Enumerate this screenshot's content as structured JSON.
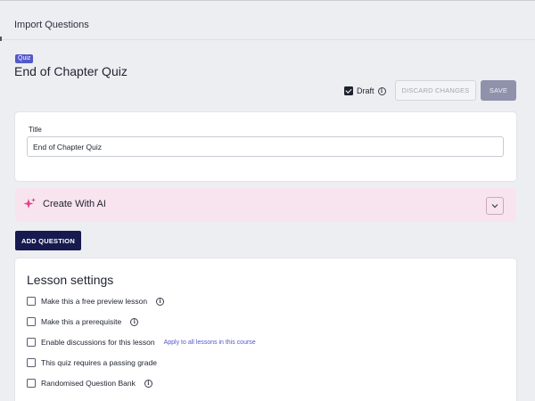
{
  "topbar": {
    "tab_label": "Import Questions"
  },
  "header": {
    "badge": "Quiz",
    "title": "End of Chapter Quiz",
    "draft_label": "Draft",
    "draft_checked": true,
    "discard_label": "DISCARD CHANGES",
    "save_label": "SAVE"
  },
  "title_card": {
    "label": "Title",
    "value": "End of Chapter Quiz"
  },
  "ai_card": {
    "label": "Create With AI",
    "icon": "sparkle-icon"
  },
  "add_question_label": "ADD QUESTION",
  "lesson_settings": {
    "title": "Lesson settings",
    "items": [
      {
        "label": "Make this a free preview lesson",
        "info": true,
        "checked": false
      },
      {
        "label": "Make this a prerequisite",
        "info": true,
        "checked": false
      },
      {
        "label": "Enable discussions for this lesson",
        "info": false,
        "checked": false,
        "link": "Apply to all lessons in this course"
      },
      {
        "label": "This quiz requires a passing grade",
        "info": false,
        "checked": false
      },
      {
        "label": "Randomised Question Bank",
        "info": true,
        "checked": false
      }
    ]
  },
  "colors": {
    "accent": "#5458c9",
    "primary_button": "#161a4f",
    "ai_background": "#f8e4ee",
    "ai_icon": "#e0408a"
  }
}
